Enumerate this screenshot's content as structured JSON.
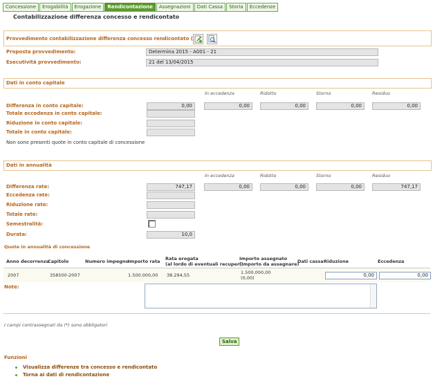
{
  "tabs": [
    "Concessione",
    "Erogabilità",
    "Erogazione",
    "Rendicontazione",
    "Assegnazioni",
    "Dati Cassa",
    "Storia",
    "Eccedenze"
  ],
  "active_tab": "Rendicontazione",
  "page_title": "Contabilizzazione differenza concesso e rendicontato",
  "provvedimento": {
    "title": "Provvedimento contabilizzazione differenza concesso rendicontato (*)",
    "proposta_label": "Proposta provvedimento:",
    "proposta_value": "Determina 2015 - A001 - 21",
    "esecutivita_label": "Esecutività provvedimento:",
    "esecutivita_value": "21 del 13/04/2015",
    "icons": [
      "edit-icon",
      "search-icon"
    ]
  },
  "conto_capitale": {
    "title": "Dati in conto capitale",
    "col_headers": [
      "In eccedenza",
      "Ridotto",
      "Storno",
      "Residuo"
    ],
    "diff_label": "Differenza in conto capitale:",
    "diff_values": [
      "0,00",
      "0,00",
      "0,00",
      "0,00",
      "0,00"
    ],
    "tot_ecc_label": "Totale eccedenza in conto capitale:",
    "rid_label": "Riduzione in conto capitale:",
    "tot_label": "Totale in conto capitale:",
    "note": "Non sono presenti quote in conto capitale di concessione"
  },
  "annualita": {
    "title": "Dati in annualità",
    "col_headers": [
      "In eccedenza",
      "Ridotto",
      "Storno",
      "Residuo"
    ],
    "diff_label": "Differenza rate:",
    "diff_values": [
      "747,17",
      "0,00",
      "0,00",
      "0,00",
      "747,17"
    ],
    "ecc_label": "Eccedenza rate:",
    "rid_label": "Riduzione rate:",
    "tot_label": "Totale rate:",
    "sem_label": "Semestralità:",
    "durata_label": "Durata:",
    "durata_value": "10,0"
  },
  "quote": {
    "title": "Quote in annualità di concessione",
    "headers": {
      "anno": "Anno decorrenza",
      "capitolo": "Capitolo",
      "numero": "Numero impegno",
      "importo": "Importo rata",
      "rata_1": "Rata erogata",
      "rata_2": "(al lordo di eventuali recuperi)",
      "assegnato_1": "Importo assegnato",
      "assegnato_2": "(Importo da assegnare)",
      "cassa": "Dati cassa",
      "riduzione": "Riduzione",
      "eccedenza": "Eccedenza"
    },
    "row": {
      "anno": "2007",
      "capitolo": "358500-2007",
      "numero": "",
      "importo": "1.500.000,00",
      "rata": "38.294,55",
      "assegnato_1": "1.500.000,00",
      "assegnato_2": "(0,00)",
      "cassa": "",
      "riduzione": "0,00",
      "eccedenza": "0,00"
    }
  },
  "note_label": "Note:",
  "required_note": "I campi contrassegnati da (*) sono obbligatori",
  "save_label": "Salva",
  "funzioni": {
    "title": "Funzioni",
    "links": [
      "Visualizza differenze tra concesso e rendicontato",
      "Torna ai dati di rendicontazione"
    ]
  },
  "colors": {
    "accent": "#5c9c2c",
    "label": "#b5651d",
    "border": "#e5c48d"
  }
}
